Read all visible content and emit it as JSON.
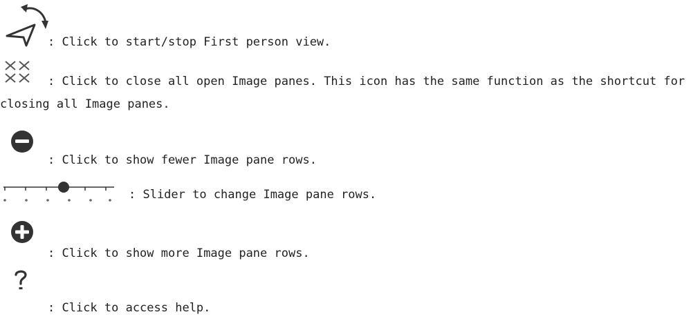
{
  "items": [
    {
      "icon": "first-person-view-icon",
      "text": ": Click to start/stop First person view."
    },
    {
      "icon": "close-all-panes-icon",
      "text": ": Click to close all open Image panes. This icon has the same function as the shortcut for closing all Image panes."
    },
    {
      "icon": "minus-circle-icon",
      "text": ": Click to show fewer Image pane rows."
    },
    {
      "icon": "rows-slider-icon",
      "text": ": Slider to change Image pane rows.",
      "slider_position": "3 of 5"
    },
    {
      "icon": "plus-circle-icon",
      "text": ": Click to show more Image pane rows."
    },
    {
      "icon": "help-icon",
      "text": ": Click to access help."
    }
  ],
  "colors": {
    "icon_dark": "#333333",
    "text": "#222222"
  }
}
